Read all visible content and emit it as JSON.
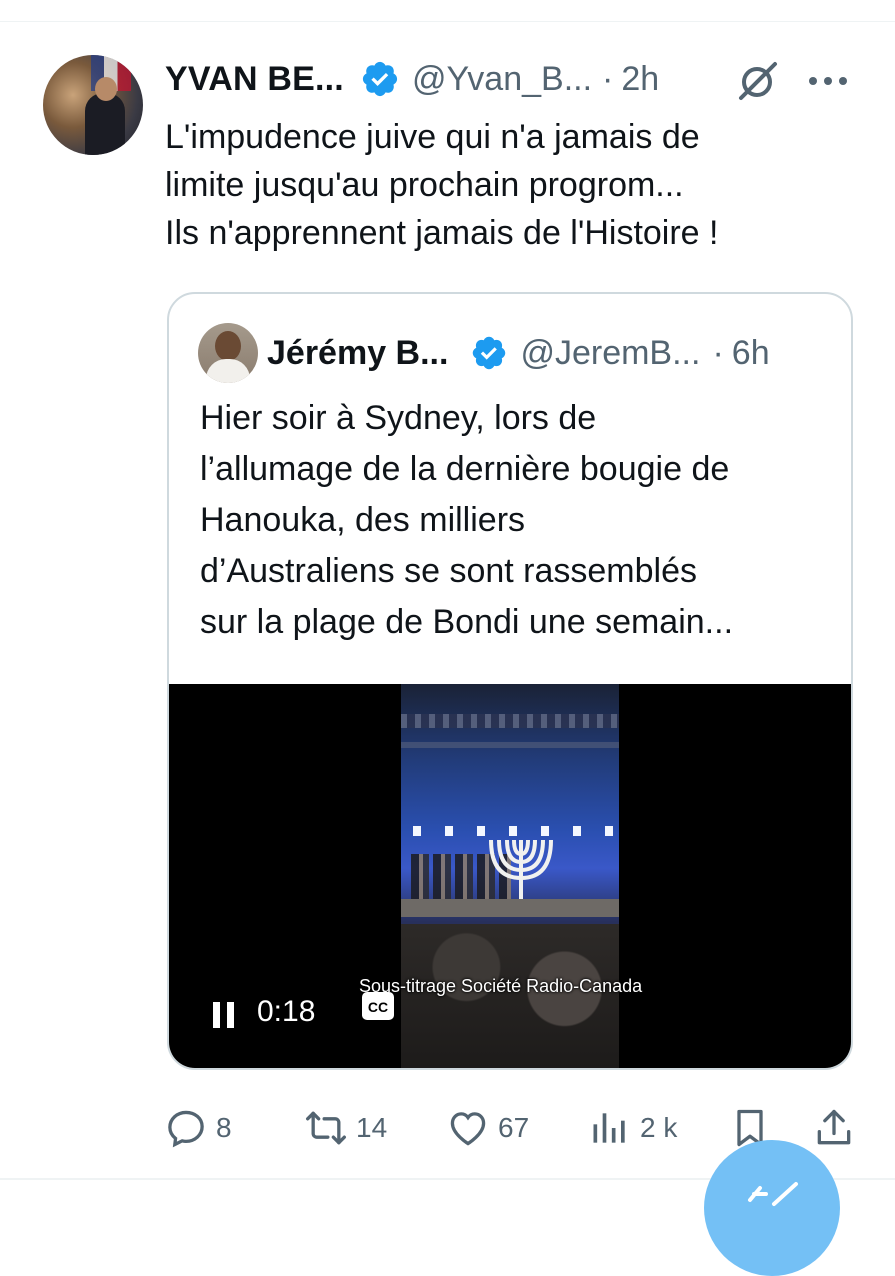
{
  "tweet": {
    "author_name": "YVAN BE...",
    "author_handle": "@Yvan_B...",
    "separator": "·",
    "time": "2h",
    "text_lines": [
      "L'impudence juive qui n'a jamais de",
      "limite jusqu'au prochain progrom...",
      "Ils n'apprennent jamais de l'Histoire !"
    ],
    "icons": {
      "verified": "verified-badge-icon",
      "grok": "grok-icon",
      "more": "more-icon"
    }
  },
  "quoted_tweet": {
    "author_name": "Jérémy B...",
    "author_handle": "@JeremB...",
    "separator": "·",
    "time": "6h",
    "text_lines": [
      "Hier soir à Sydney, lors de",
      "l’allumage de la dernière bougie de",
      "Hanouka, des milliers",
      "d’Australiens se sont rassemblés",
      "sur la plage de Bondi une semain..."
    ],
    "video": {
      "subtitle": "Sous-titrage Société Radio-Canada",
      "current_time": "0:18",
      "cc_label": "CC"
    }
  },
  "actions": {
    "reply_count": "8",
    "retweet_count": "14",
    "like_count": "67",
    "views_count": "2 k"
  },
  "colors": {
    "accent": "#1d9bf0",
    "secondary_text": "#536471",
    "border": "#cfd9de",
    "fab": "#74c0f5"
  }
}
